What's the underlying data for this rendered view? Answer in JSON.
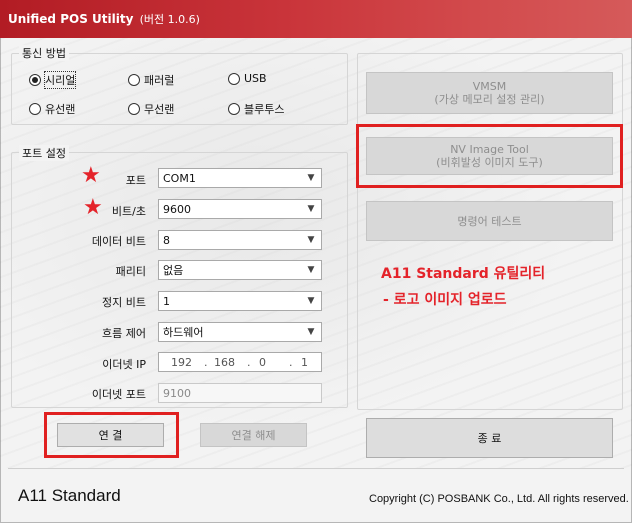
{
  "window": {
    "title": "Unified POS Utility",
    "version_label": "(버전 1.0.6)"
  },
  "comm": {
    "group_label": "통신 방법",
    "options": [
      {
        "label": "시리얼",
        "selected": true
      },
      {
        "label": "패러럴",
        "selected": false
      },
      {
        "label": "USB",
        "selected": false
      },
      {
        "label": "유선랜",
        "selected": false
      },
      {
        "label": "무선랜",
        "selected": false
      },
      {
        "label": "블루투스",
        "selected": false
      }
    ]
  },
  "port": {
    "group_label": "포트 설정",
    "port_label": "포트",
    "port_value": "COM1",
    "baud_label": "비트/초",
    "baud_value": "9600",
    "databits_label": "데이터 비트",
    "databits_value": "8",
    "parity_label": "패리티",
    "parity_value": "없음",
    "stopbits_label": "정지 비트",
    "stopbits_value": "1",
    "flow_label": "흐름 제어",
    "flow_value": "하드웨어",
    "ip_label": "이더넷 IP",
    "ip_parts": [
      "192",
      "168",
      "0",
      "1"
    ],
    "ip_dots": ".",
    "ethport_label": "이더넷 포트",
    "ethport_value": "9100"
  },
  "buttons": {
    "connect": "연 결",
    "disconnect": "연결 해제",
    "vmsm_line1": "VMSM",
    "vmsm_line2": "(가상 메모리 설정 관리)",
    "nv_line1": "NV Image Tool",
    "nv_line2": "(비휘발성 이미지 도구)",
    "command_test": "명령어 테스트",
    "exit": "종   료"
  },
  "annotation": {
    "line1": "A11 Standard 유틸리티",
    "line2": "- 로고 이미지 업로드"
  },
  "footer": {
    "product": "A11 Standard",
    "copyright": "Copyright (C) POSBANK Co., Ltd. All rights reserved."
  },
  "colors": {
    "title_bar": "#c12a30",
    "highlight": "#e02020",
    "annotation": "#e4232a"
  }
}
